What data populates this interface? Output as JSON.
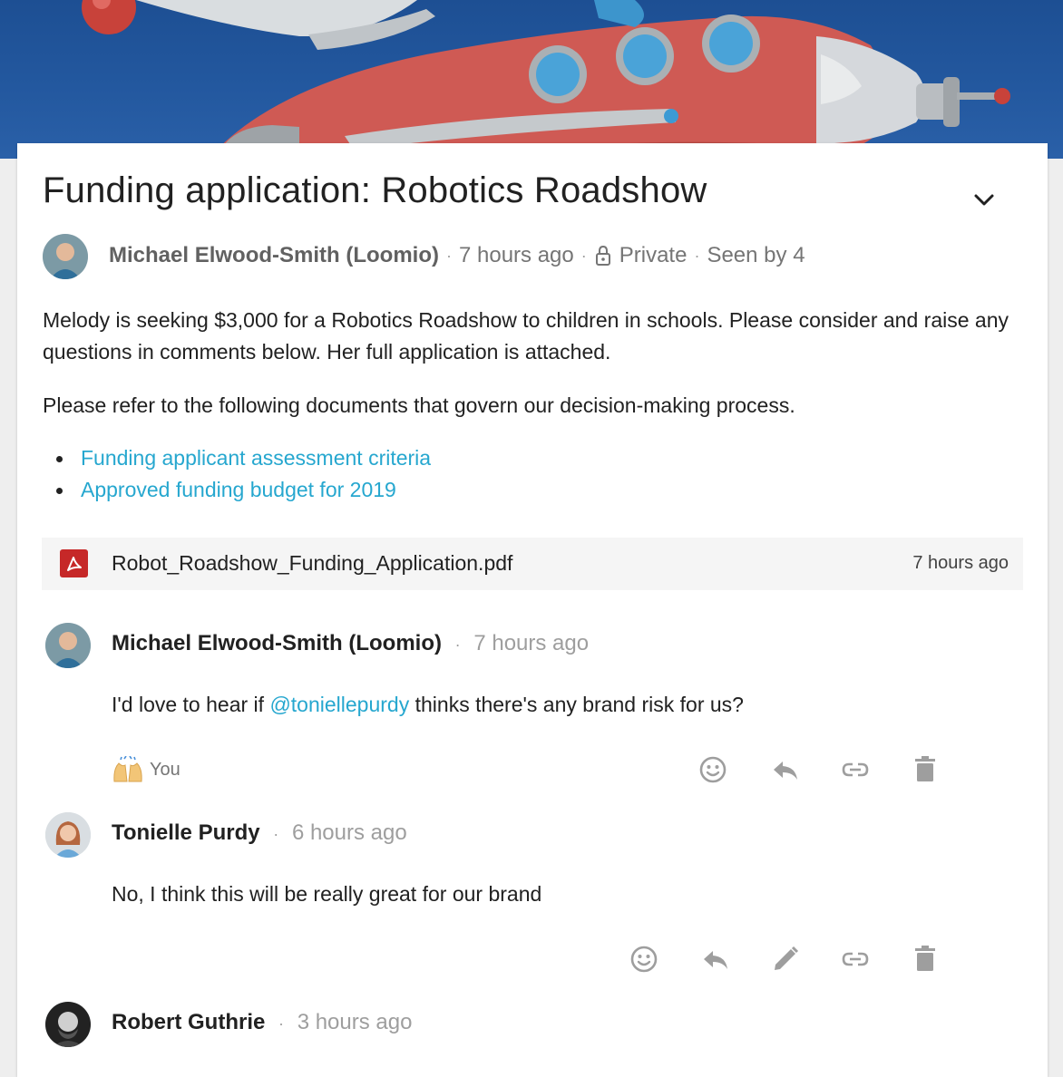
{
  "discussion": {
    "title": "Funding application: Robotics Roadshow",
    "author": "Michael Elwood-Smith (Loomio)",
    "time": "7 hours ago",
    "privacy": "Private",
    "seen_by": "Seen by 4",
    "paragraph1": "Melody is seeking $3,000 for a Robotics Roadshow to children in schools. Please consider and raise any questions in comments below. Her full application is attached.",
    "paragraph2": "Please refer to the following documents that govern our decision-making process.",
    "links": [
      "Funding applicant assessment criteria",
      "Approved funding budget for 2019"
    ],
    "attachment": {
      "filename": "Robot_Roadshow_Funding_Application.pdf",
      "time": "7 hours ago"
    }
  },
  "comments": [
    {
      "author": "Michael Elwood-Smith (Loomio)",
      "time": "7 hours ago",
      "text_before": "I'd love to hear if ",
      "mention": "@toniellepurdy",
      "text_after": " thinks there's any brand risk for us?",
      "reaction_user": "You"
    },
    {
      "author": "Tonielle Purdy",
      "time": "6 hours ago",
      "text": "No, I think this will be really great for our brand"
    },
    {
      "author": "Robert Guthrie",
      "time": "3 hours ago"
    }
  ],
  "icons": {
    "expand": "chevron-down-icon",
    "lock": "lock-icon",
    "pdf": "pdf-icon",
    "react": "smiley-icon",
    "reply": "reply-icon",
    "edit": "pencil-icon",
    "link": "link-icon",
    "delete": "trash-icon",
    "reaction_emoji": "raised-hands-icon"
  },
  "colors": {
    "link": "#26a7cf",
    "banner": "#23589f",
    "pdf_red": "#c62828"
  }
}
